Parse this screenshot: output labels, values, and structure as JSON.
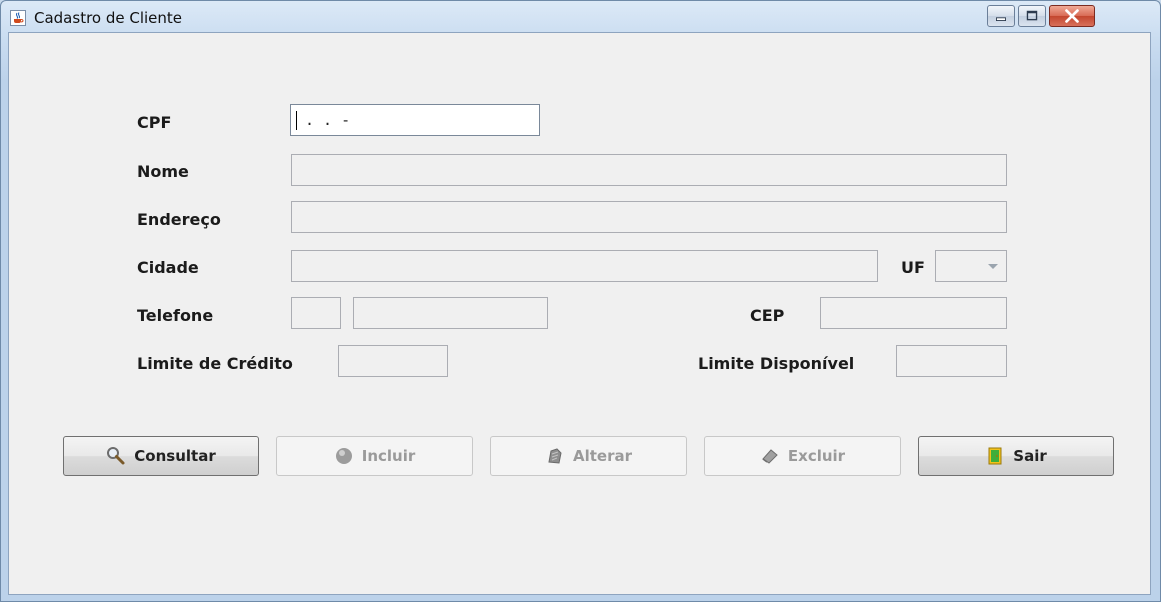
{
  "window": {
    "title": "Cadastro de Cliente",
    "icon": "java-cup-icon",
    "controls": [
      "minimize-icon",
      "maximize-icon",
      "close-icon"
    ]
  },
  "form": {
    "cpf": {
      "label": "CPF",
      "value": ". . -"
    },
    "nome": {
      "label": "Nome",
      "value": ""
    },
    "endereco": {
      "label": "Endereço",
      "value": ""
    },
    "cidade": {
      "label": "Cidade",
      "value": ""
    },
    "uf": {
      "label": "UF",
      "value": ""
    },
    "telefone": {
      "label": "Telefone",
      "ddd": "",
      "numero": ""
    },
    "cep": {
      "label": "CEP",
      "value": ""
    },
    "limite_credito": {
      "label": "Limite de Crédito",
      "value": ""
    },
    "limite_disponivel": {
      "label": "Limite Disponível",
      "value": ""
    }
  },
  "buttons": {
    "consultar": {
      "label": "Consultar",
      "icon": "magnifier-icon",
      "enabled": true
    },
    "incluir": {
      "label": "Incluir",
      "icon": "add-circle-icon",
      "enabled": false
    },
    "alterar": {
      "label": "Alterar",
      "icon": "edit-icon",
      "enabled": false
    },
    "excluir": {
      "label": "Excluir",
      "icon": "eraser-icon",
      "enabled": false
    },
    "sair": {
      "label": "Sair",
      "icon": "exit-door-icon",
      "enabled": true
    }
  },
  "colors": {
    "client_bg": "#f0f0f0",
    "title_bar": "#c9dcf0",
    "close_button": "#c3462f",
    "exit_icon": "#f2c21b"
  }
}
